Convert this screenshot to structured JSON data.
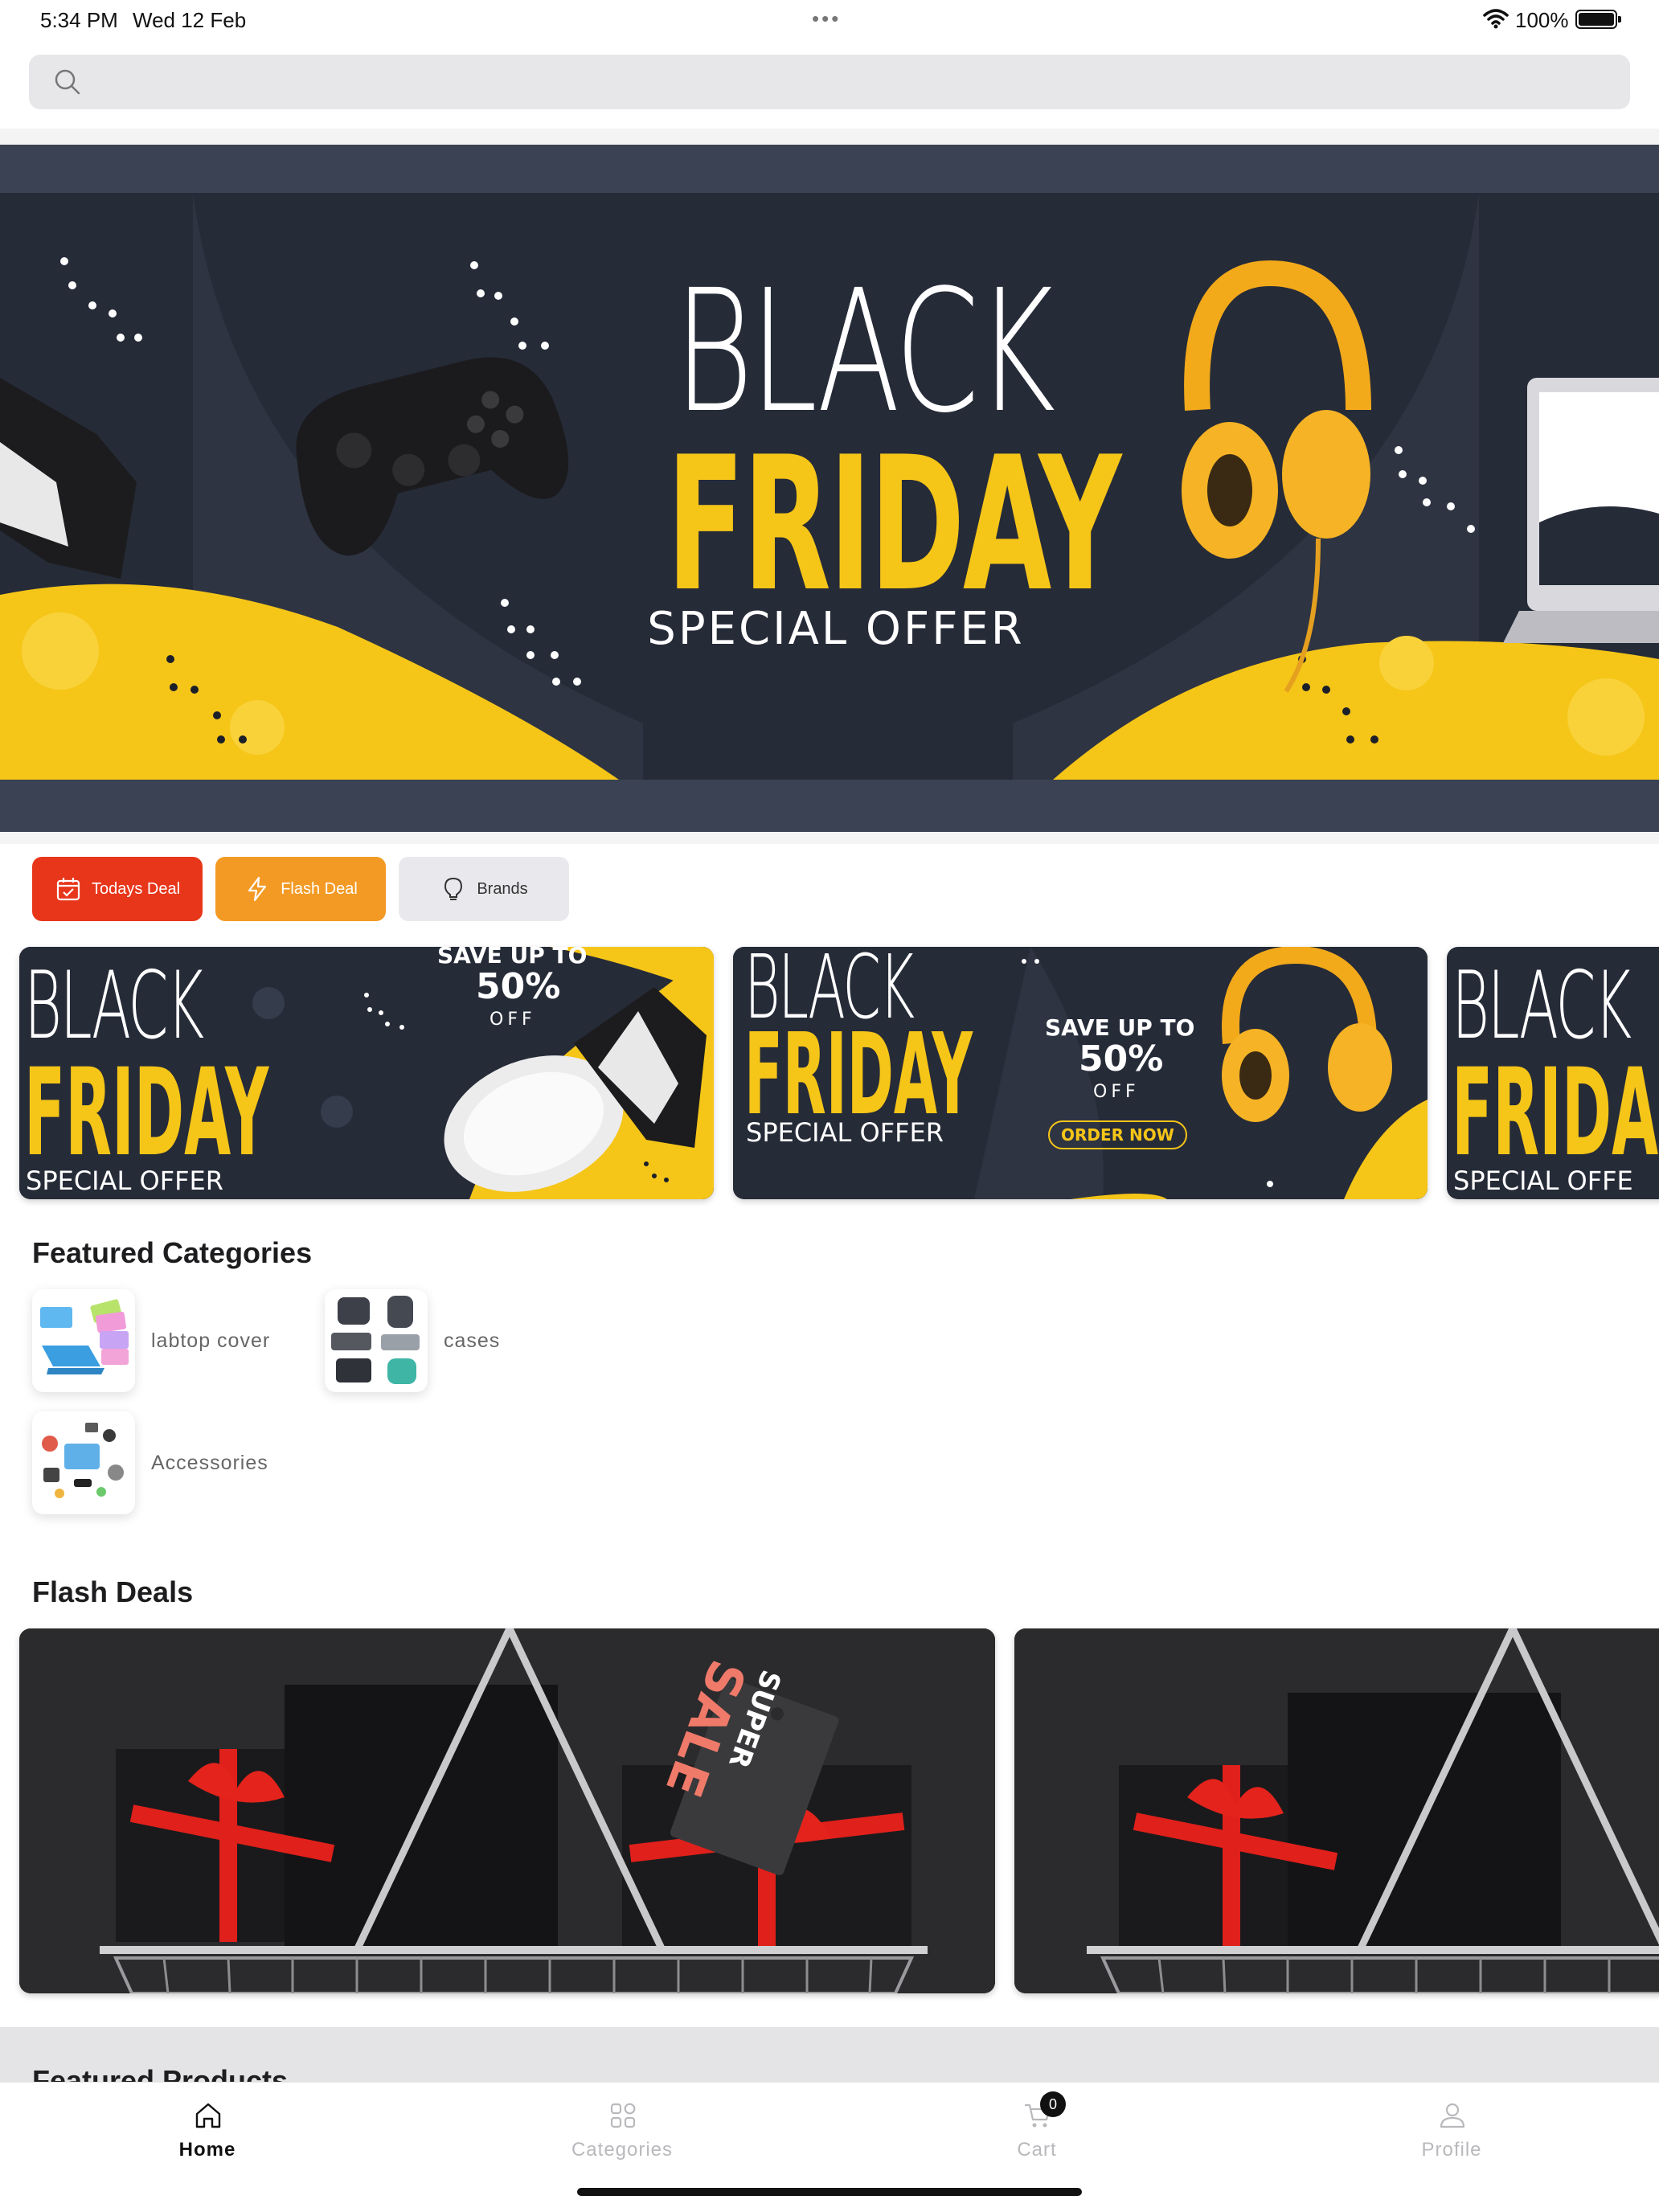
{
  "status_bar": {
    "time": "5:34 PM",
    "date": "Wed 12 Feb",
    "battery_percent": "100%"
  },
  "search": {
    "placeholder": ""
  },
  "hero_banner": {
    "line1": "BLACK",
    "line2": "FRIDAY",
    "line3": "SPECIAL OFFER"
  },
  "quick_actions": [
    {
      "label": "Todays Deal",
      "icon": "calendar-check-icon",
      "color": "#e8361a"
    },
    {
      "label": "Flash Deal",
      "icon": "lightning-icon",
      "color": "#f39a24"
    },
    {
      "label": "Brands",
      "icon": "lightbulb-icon",
      "color": "#e9e9ed"
    }
  ],
  "promo_cards": [
    {
      "line1": "BLACK",
      "line2": "FRIDAY",
      "line3": "SPECIAL OFFER",
      "save": "SAVE UP TO",
      "pct": "50%",
      "off": "OFF"
    },
    {
      "line1": "BLACK",
      "line2": "FRIDAY",
      "line3": "SPECIAL OFFER",
      "save": "SAVE UP TO",
      "pct": "50%",
      "off": "OFF",
      "cta": "ORDER NOW"
    },
    {
      "line1": "BLACK",
      "line2": "FRIDA",
      "line3": "SPECIAL OFFE"
    }
  ],
  "featured_categories": {
    "title": "Featured Categories",
    "items": [
      {
        "label": "labtop cover"
      },
      {
        "label": "cases"
      },
      {
        "label": "Accessories"
      }
    ]
  },
  "flash_deals": {
    "title": "Flash Deals",
    "tag_line1": "SUPER",
    "tag_line2": "SALE"
  },
  "featured_products": {
    "title": "Featured Products"
  },
  "tab_bar": {
    "home": "Home",
    "categories": "Categories",
    "cart": "Cart",
    "cart_count": "0",
    "profile": "Profile"
  },
  "colors": {
    "accent_red": "#e8361a",
    "accent_orange": "#f39a24",
    "banner_yellow": "#f5c518",
    "banner_dark": "#262b38"
  }
}
